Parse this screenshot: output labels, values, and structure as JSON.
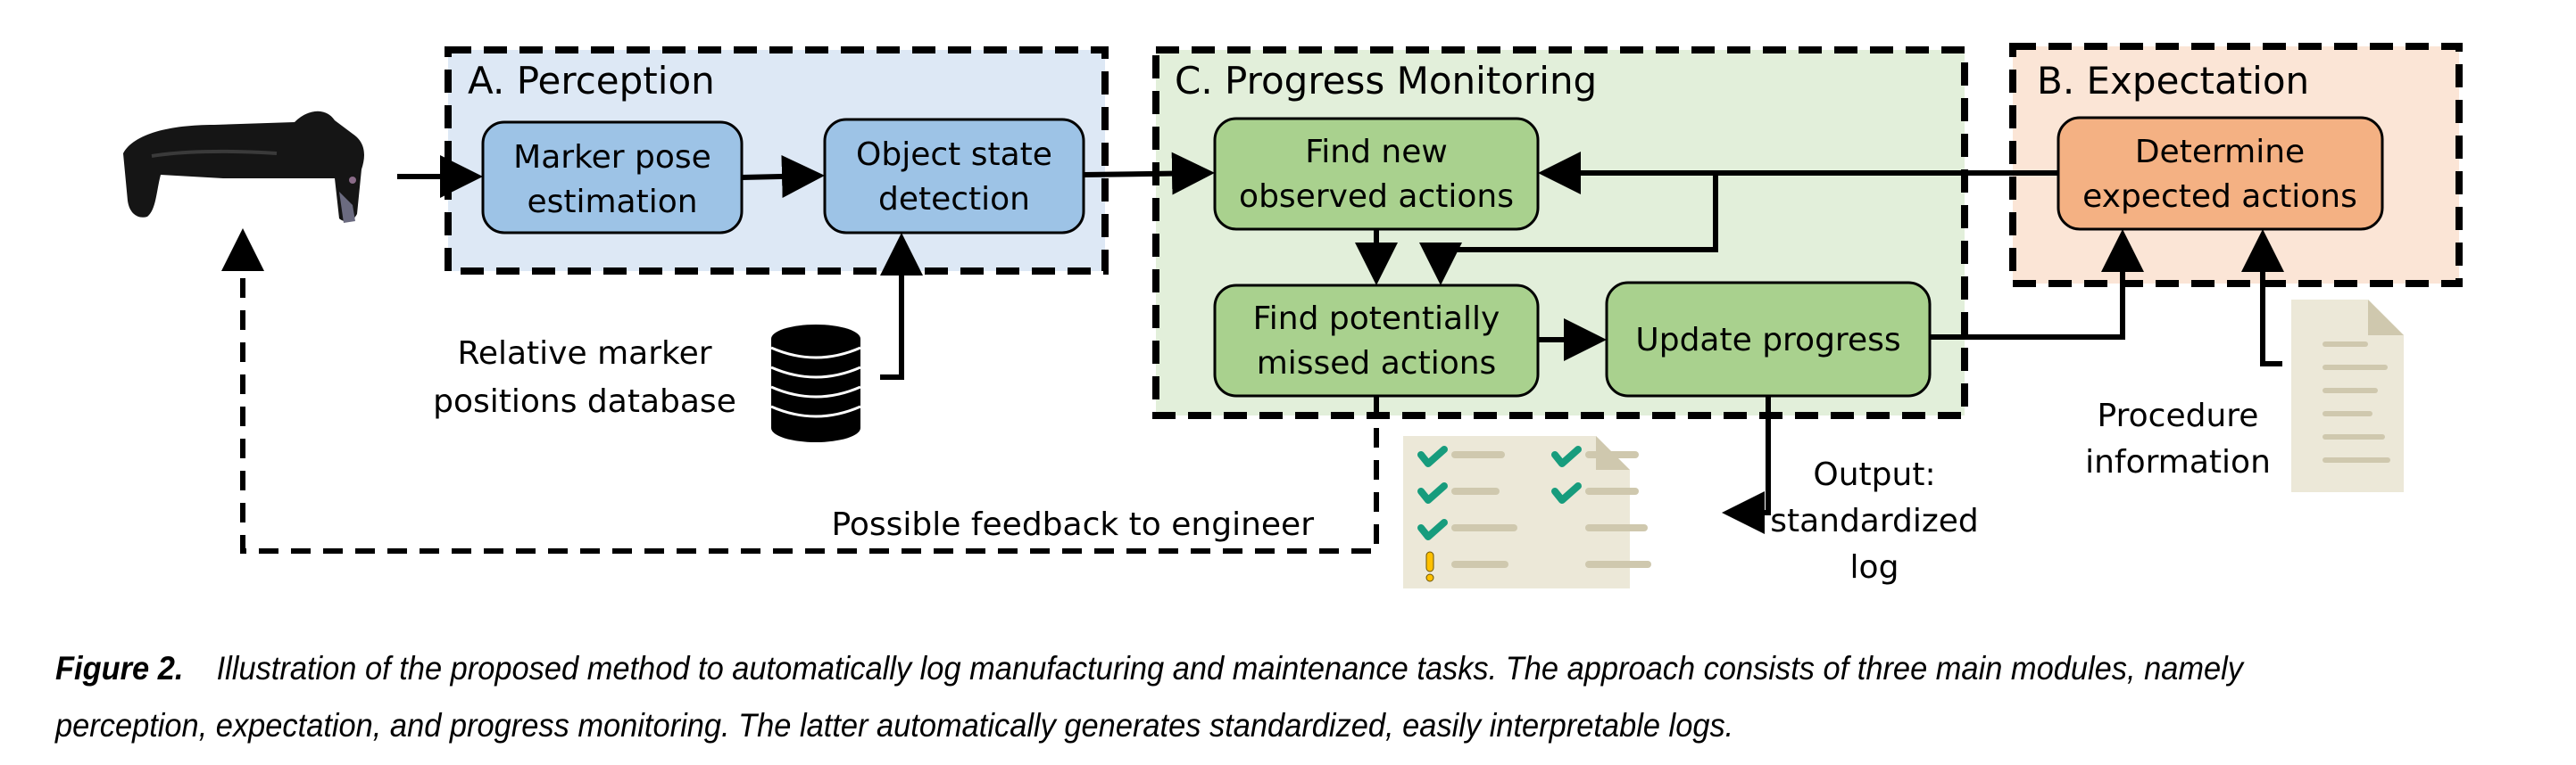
{
  "modules": {
    "perception": {
      "title": "A. Perception",
      "fill": "#dde8f5",
      "boxes": [
        {
          "lines": [
            "Marker pose",
            "estimation"
          ],
          "fill": "#9dc3e6"
        },
        {
          "lines": [
            "Object state",
            "detection"
          ],
          "fill": "#9dc3e6"
        }
      ]
    },
    "progress_monitoring": {
      "title": "C. Progress Monitoring",
      "fill": "#e2efda",
      "boxes": [
        {
          "lines": [
            "Find new",
            "observed actions"
          ],
          "fill": "#a9d18e"
        },
        {
          "lines": [
            "Find potentially",
            "missed actions"
          ],
          "fill": "#a9d18e"
        },
        {
          "lines": [
            "Update progress"
          ],
          "fill": "#a9d18e"
        }
      ]
    },
    "expectation": {
      "title": "B. Expectation",
      "fill": "#fbe5d6",
      "boxes": [
        {
          "lines": [
            "Determine",
            "expected actions"
          ],
          "fill": "#f4b183"
        }
      ]
    }
  },
  "labels": {
    "database": [
      "Relative marker",
      "positions database"
    ],
    "feedback": "Possible feedback to engineer",
    "output": [
      "Output:",
      "standardized",
      "log"
    ],
    "procedure": [
      "Procedure",
      "information"
    ]
  },
  "icons": {
    "headset": "mixed-reality-headset",
    "database": "database-icon",
    "log_document": "checklist-document",
    "procedure_document": "text-document"
  },
  "log_items": [
    {
      "status": "check",
      "column": 1
    },
    {
      "status": "check",
      "column": 1
    },
    {
      "status": "check",
      "column": 1
    },
    {
      "status": "warning",
      "column": 1
    },
    {
      "status": "check",
      "column": 2
    },
    {
      "status": "check",
      "column": 2
    },
    {
      "status": "none",
      "column": 2
    },
    {
      "status": "none",
      "column": 2
    }
  ],
  "colors": {
    "check": "#179c7d",
    "warning": "#ffc000",
    "document": "#ece8d8",
    "document_line": "#cfc8ae"
  },
  "caption": {
    "label": "Figure 2.",
    "text": "Illustration of the proposed method to automatically log manufacturing and maintenance tasks. The approach consists of three main modules, namely perception, expectation, and progress monitoring. The latter automatically generates standardized, easily interpretable logs."
  }
}
